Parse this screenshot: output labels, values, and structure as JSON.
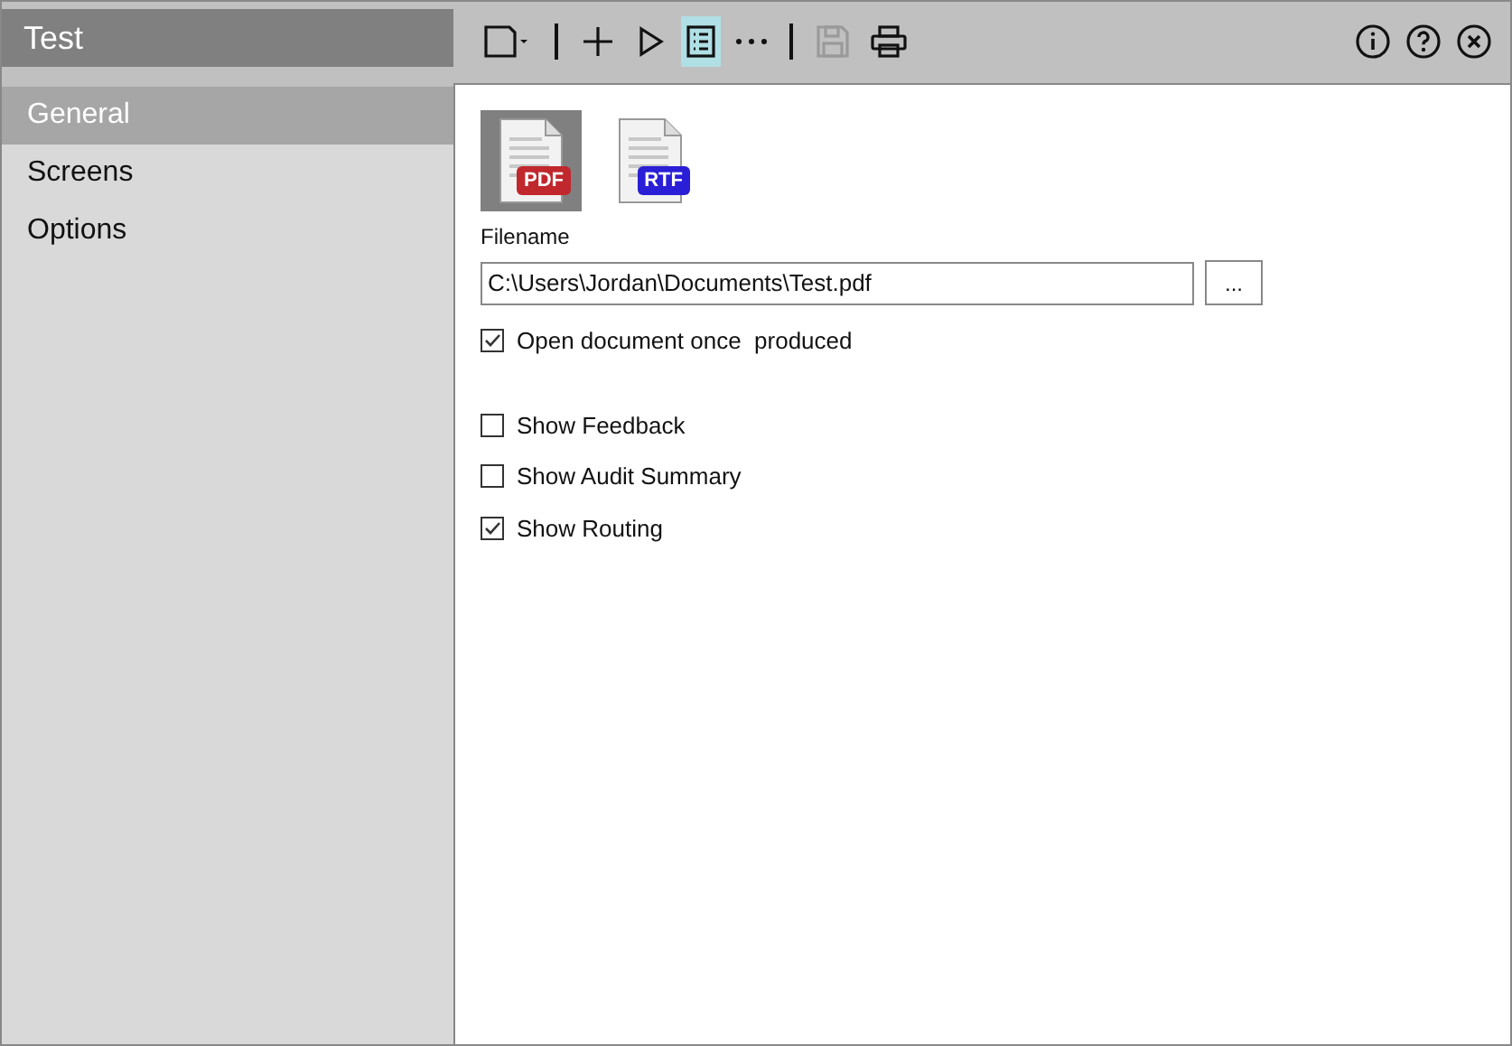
{
  "window": {
    "title": "Test"
  },
  "sidebar": {
    "items": [
      {
        "label": "General",
        "selected": true
      },
      {
        "label": "Screens",
        "selected": false
      },
      {
        "label": "Options",
        "selected": false
      }
    ]
  },
  "toolbar": {
    "tools": [
      {
        "kind": "new",
        "selected": false,
        "disabled": false
      },
      {
        "kind": "divider"
      },
      {
        "kind": "add",
        "selected": false,
        "disabled": false
      },
      {
        "kind": "run",
        "selected": false,
        "disabled": false
      },
      {
        "kind": "list",
        "selected": true,
        "disabled": false
      },
      {
        "kind": "more",
        "selected": false,
        "disabled": false
      },
      {
        "kind": "divider"
      },
      {
        "kind": "save",
        "selected": false,
        "disabled": true
      },
      {
        "kind": "print",
        "selected": false,
        "disabled": false
      }
    ],
    "window_buttons": [
      {
        "kind": "info"
      },
      {
        "kind": "help"
      },
      {
        "kind": "close"
      }
    ]
  },
  "formats": [
    {
      "badge": "PDF",
      "color": "#c0282d",
      "selected": true
    },
    {
      "badge": "RTF",
      "color": "#2a1fd6",
      "selected": false
    }
  ],
  "filename": {
    "label": "Filename",
    "value": "C:\\Users\\Jordan\\Documents\\Test.pdf",
    "browse": "..."
  },
  "open_option": {
    "label": "Open document once  produced",
    "checked": true
  },
  "display_options": [
    {
      "label": "Show Feedback",
      "checked": false
    },
    {
      "label": "Show Audit Summary",
      "checked": false
    },
    {
      "label": "Show Routing",
      "checked": true
    }
  ]
}
